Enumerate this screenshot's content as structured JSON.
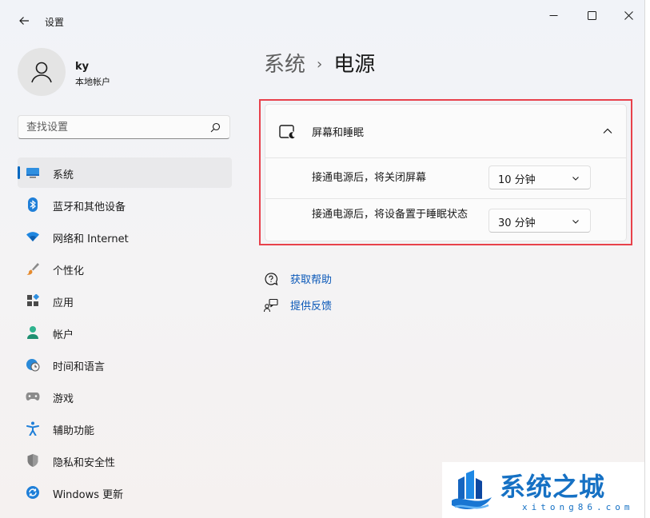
{
  "window": {
    "title": "设置",
    "controls": [
      "minimize-icon",
      "maximize-icon",
      "close-icon"
    ]
  },
  "account": {
    "name": "ky",
    "type": "本地帐户"
  },
  "search": {
    "placeholder": "查找设置"
  },
  "sidebar": {
    "items": [
      {
        "label": "系统",
        "icon": "system-display-icon",
        "active": true
      },
      {
        "label": "蓝牙和其他设备",
        "icon": "bluetooth-icon"
      },
      {
        "label": "网络和 Internet",
        "icon": "wifi-icon"
      },
      {
        "label": "个性化",
        "icon": "brush-icon"
      },
      {
        "label": "应用",
        "icon": "apps-icon"
      },
      {
        "label": "帐户",
        "icon": "account-icon"
      },
      {
        "label": "时间和语言",
        "icon": "globe-clock-icon"
      },
      {
        "label": "游戏",
        "icon": "gamepad-icon"
      },
      {
        "label": "辅助功能",
        "icon": "accessibility-icon"
      },
      {
        "label": "隐私和安全性",
        "icon": "shield-icon"
      },
      {
        "label": "Windows 更新",
        "icon": "update-icon"
      }
    ]
  },
  "main": {
    "breadcrumb": {
      "parent": "系统",
      "separator": "›",
      "current": "电源"
    },
    "screen_sleep": {
      "title": "屏幕和睡眠",
      "expanded": true,
      "rows": [
        {
          "label": "接通电源后，将关闭屏幕",
          "value": "10 分钟"
        },
        {
          "label": "接通电源后，将设备置于睡眠状态",
          "value": "30 分钟"
        }
      ]
    },
    "links": {
      "help": "获取帮助",
      "feedback": "提供反馈"
    }
  },
  "watermark": {
    "brand": "系统之城",
    "url": "xitong86.com"
  },
  "colors": {
    "accent": "#0067c0",
    "link": "#0a58b8",
    "highlight_border": "#e8414b",
    "watermark": "#1671c4"
  }
}
